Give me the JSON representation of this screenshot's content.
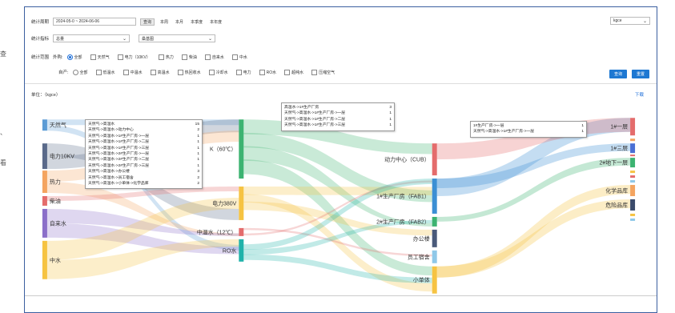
{
  "side_marks": [
    "查",
    "、",
    "看"
  ],
  "filters": {
    "period_label": "统计周期",
    "date_range": "2024-05-0 ~ 2024-06-06",
    "query_button": "查询",
    "quick_ranges": [
      "本周",
      "本月",
      "本季度",
      "本年度"
    ],
    "unit_select": "kgce",
    "metric_label": "统计指标",
    "metric_value": "总量",
    "view_value": "桑基图",
    "scope_label": "统计范围",
    "outer_label": "外购:",
    "outer_options": [
      {
        "label": "全部",
        "type": "radio",
        "checked": true
      },
      {
        "label": "天然气",
        "type": "checkbox"
      },
      {
        "label": "电力（10KV）",
        "type": "checkbox"
      },
      {
        "label": "热力",
        "type": "checkbox"
      },
      {
        "label": "柴油",
        "type": "checkbox"
      },
      {
        "label": "自来水",
        "type": "checkbox"
      },
      {
        "label": "中水",
        "type": "checkbox"
      }
    ],
    "inner_label": "自产:",
    "inner_options": [
      {
        "label": "全部",
        "type": "radio",
        "checked": false
      },
      {
        "label": "低温水",
        "type": "checkbox"
      },
      {
        "label": "中温水",
        "type": "checkbox"
      },
      {
        "label": "高温水",
        "type": "checkbox"
      },
      {
        "label": "热回收水",
        "type": "checkbox"
      },
      {
        "label": "冷却水",
        "type": "checkbox"
      },
      {
        "label": "电力",
        "type": "checkbox"
      },
      {
        "label": "RO水",
        "type": "checkbox"
      },
      {
        "label": "超纯水",
        "type": "checkbox"
      },
      {
        "label": "压缩空气",
        "type": "checkbox"
      }
    ],
    "btn_query": "查询",
    "btn_reset": "重置"
  },
  "unit_label": "单位：（kgce）",
  "download_label": "下载",
  "colors": {
    "frame": "#3b5fa0",
    "accent": "#1e78d2"
  },
  "sankey": {
    "col1": [
      {
        "name": "天然气",
        "color": "#5b9bd5"
      },
      {
        "name": "电力10KV",
        "color": "#5a6a8a"
      },
      {
        "name": "热力",
        "color": "#f4a460"
      },
      {
        "name": "柴油",
        "color": "#e46c6c"
      },
      {
        "name": "自来水",
        "color": "#8b6fc9"
      },
      {
        "name": "中水",
        "color": "#f6c342"
      }
    ],
    "col2": [
      {
        "name": "高温水（60℃）",
        "label": "K（60℃）",
        "color": "#3cb371"
      },
      {
        "name": "电力380V",
        "label": "电力380V",
        "color": "#f6c342"
      },
      {
        "name": "中温水（12℃）",
        "label": "中温水（12℃）",
        "color": "#e46c6c"
      },
      {
        "name": "RO水",
        "label": "RO水",
        "color": "#20b2aa"
      }
    ],
    "col3": [
      {
        "name": "动力中心（CUB）",
        "color": "#e46c6c"
      },
      {
        "name": "1#生产厂房（FAB1）",
        "color": "#3b8fd4"
      },
      {
        "name": "2#生产厂房（FAB2）",
        "color": "#3cb371"
      },
      {
        "name": "办公楼",
        "color": "#4a5a7a"
      },
      {
        "name": "员工宿舍",
        "color": "#8fc8e8"
      },
      {
        "name": "小单体",
        "color": "#f6c342"
      }
    ],
    "col4": [
      {
        "name": "1#一层",
        "color": "#e46c6c"
      },
      {
        "name": "1#三层",
        "color": "#4a6fd4"
      },
      {
        "name": "2#地下一层",
        "color": "#3cb371"
      },
      {
        "name": "化学品库",
        "color": "#f4a460"
      },
      {
        "name": "危险品库",
        "color": "#3a4a6a"
      }
    ]
  },
  "tooltip_left": [
    {
      "path": "天然气->高温水",
      "value": "15"
    },
    {
      "path": "天然气->高温水->动力中心",
      "value": "2"
    },
    {
      "path": "天然气->高温水->1#生产厂房->一层",
      "value": "1"
    },
    {
      "path": "天然气->高温水->1#生产厂房->二层",
      "value": "1"
    },
    {
      "path": "天然气->高温水->1#生产厂房->三层",
      "value": "1"
    },
    {
      "path": "天然气->高温水->2#生产厂房->一层",
      "value": "1"
    },
    {
      "path": "天然气->高温水->2#生产厂房->二层",
      "value": "1"
    },
    {
      "path": "天然气->高温水->2#生产厂房->三层",
      "value": "1"
    },
    {
      "path": "天然气->高温水->办公楼",
      "value": "3"
    },
    {
      "path": "天然气->高温水->员工宿舍",
      "value": "2"
    },
    {
      "path": "天然气->高温水->小单体->化学品库",
      "value": "2"
    }
  ],
  "tooltip_mid": [
    {
      "path": "高温水->1#生产厂房",
      "value": "3"
    },
    {
      "path": "天然气->高温水->1#生产厂房->一层",
      "value": "1"
    },
    {
      "path": "天然气->高温水->1#生产厂房->二层",
      "value": "1"
    },
    {
      "path": "天然气->高温水->1#生产厂房->三层",
      "value": "1"
    }
  ],
  "tooltip_right": [
    {
      "path": "1#生产厂房->一层",
      "value": "1"
    },
    {
      "path": "天然气->高温水->1#生产厂房->一层",
      "value": "1"
    }
  ]
}
